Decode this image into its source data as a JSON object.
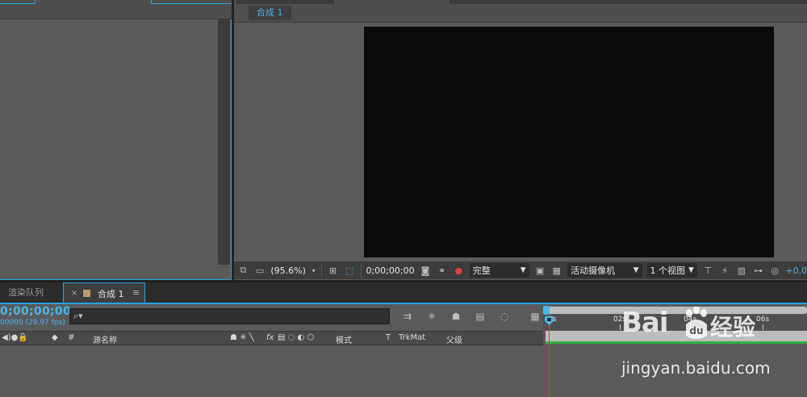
{
  "composition": {
    "tab_label": "合成 1"
  },
  "viewer_toolbar": {
    "zoom": "(95.6%)",
    "timecode": "0;00;00;00",
    "resolution": "完整",
    "camera": "活动摄像机",
    "views": "1 个视图",
    "exposure": "+0.0"
  },
  "panel_tabs": {
    "render_queue": "渲染队列",
    "comp_close": "×",
    "comp_label": "合成 1",
    "comp_menu": "≡",
    "comp_color": "#b99a72"
  },
  "timeline": {
    "timecode": "0;00;00;00",
    "fps": "00000 (29.97 fps)",
    "search_placeholder": "⌕▾",
    "columns": {
      "hash": "#",
      "source_name": "源名称",
      "fx": "fx",
      "mode": "模式",
      "t": "T",
      "trkmat": "TrkMat",
      "parent": "父级"
    },
    "ruler_ticks": [
      "0s",
      "02s",
      "04s",
      "06s"
    ]
  },
  "watermark": {
    "logo": "Bai",
    "logo_cn": "经验",
    "url": "jingyan.baidu.com"
  },
  "colors": {
    "accent": "#48b4ec",
    "panel": "#5a5a5a",
    "canvas": "#0b0b0b",
    "playhead": "#e23a3a",
    "layer_green": "#33b04a"
  }
}
